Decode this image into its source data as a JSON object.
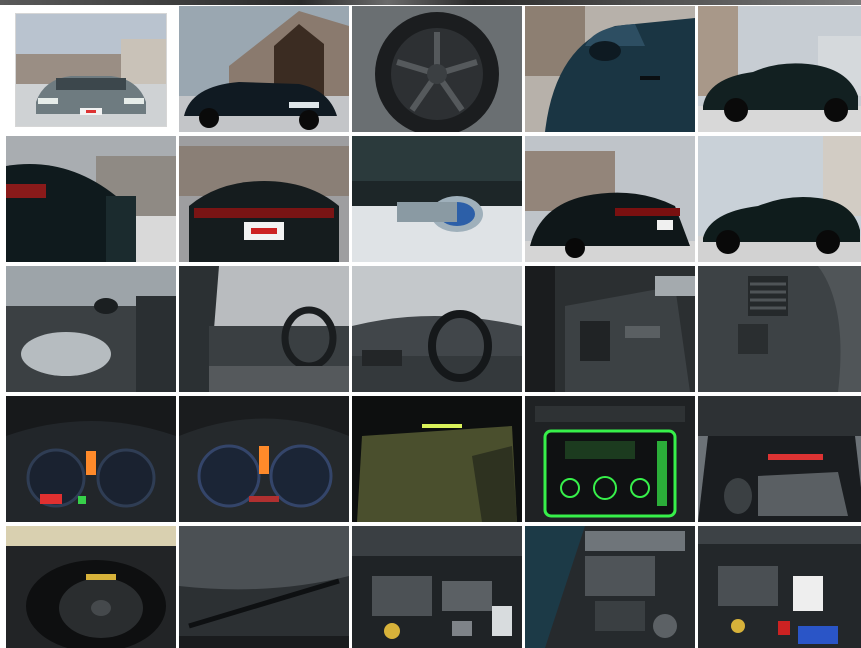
{
  "gallery": {
    "selected_index": 0,
    "photos": [
      {
        "name": "front-view",
        "plate_text": "..."
      },
      {
        "name": "front-left-view",
        "plate_text": ""
      },
      {
        "name": "wheel-rim",
        "plate_text": ""
      },
      {
        "name": "left-side-mirror",
        "plate_text": ""
      },
      {
        "name": "side-profile",
        "plate_text": ""
      },
      {
        "name": "rear-left-quarter",
        "plate_text": ""
      },
      {
        "name": "rear-view",
        "plate_text": "..."
      },
      {
        "name": "exhaust-tip",
        "plate_text": ""
      },
      {
        "name": "rear-right-quarter",
        "plate_text": ""
      },
      {
        "name": "side-profile-right",
        "plate_text": ""
      },
      {
        "name": "door-interior",
        "plate_text": ""
      },
      {
        "name": "cabin-interior",
        "plate_text": ""
      },
      {
        "name": "dashboard-steering",
        "plate_text": ""
      },
      {
        "name": "door-panel-detail",
        "plate_text": ""
      },
      {
        "name": "air-vent",
        "plate_text": ""
      },
      {
        "name": "instrument-cluster",
        "plate_text": ""
      },
      {
        "name": "instrument-cluster-2",
        "plate_text": ""
      },
      {
        "name": "trunk-floor",
        "plate_text": ""
      },
      {
        "name": "stereo-head-unit",
        "plate_text": ""
      },
      {
        "name": "trunk-open",
        "plate_text": ""
      },
      {
        "name": "spare-tire",
        "plate_text": ""
      },
      {
        "name": "windshield-wiper",
        "plate_text": ""
      },
      {
        "name": "engine-bay",
        "plate_text": ""
      },
      {
        "name": "engine-bay-left",
        "plate_text": ""
      },
      {
        "name": "engine-bay-right",
        "plate_text": ""
      }
    ]
  },
  "colors": {
    "background": "#ffffff",
    "car_paint": "#1c2a26",
    "plate": "#f2f2f2",
    "dash_orange": "#ff8a2a",
    "stereo_green": "#37f04a"
  }
}
